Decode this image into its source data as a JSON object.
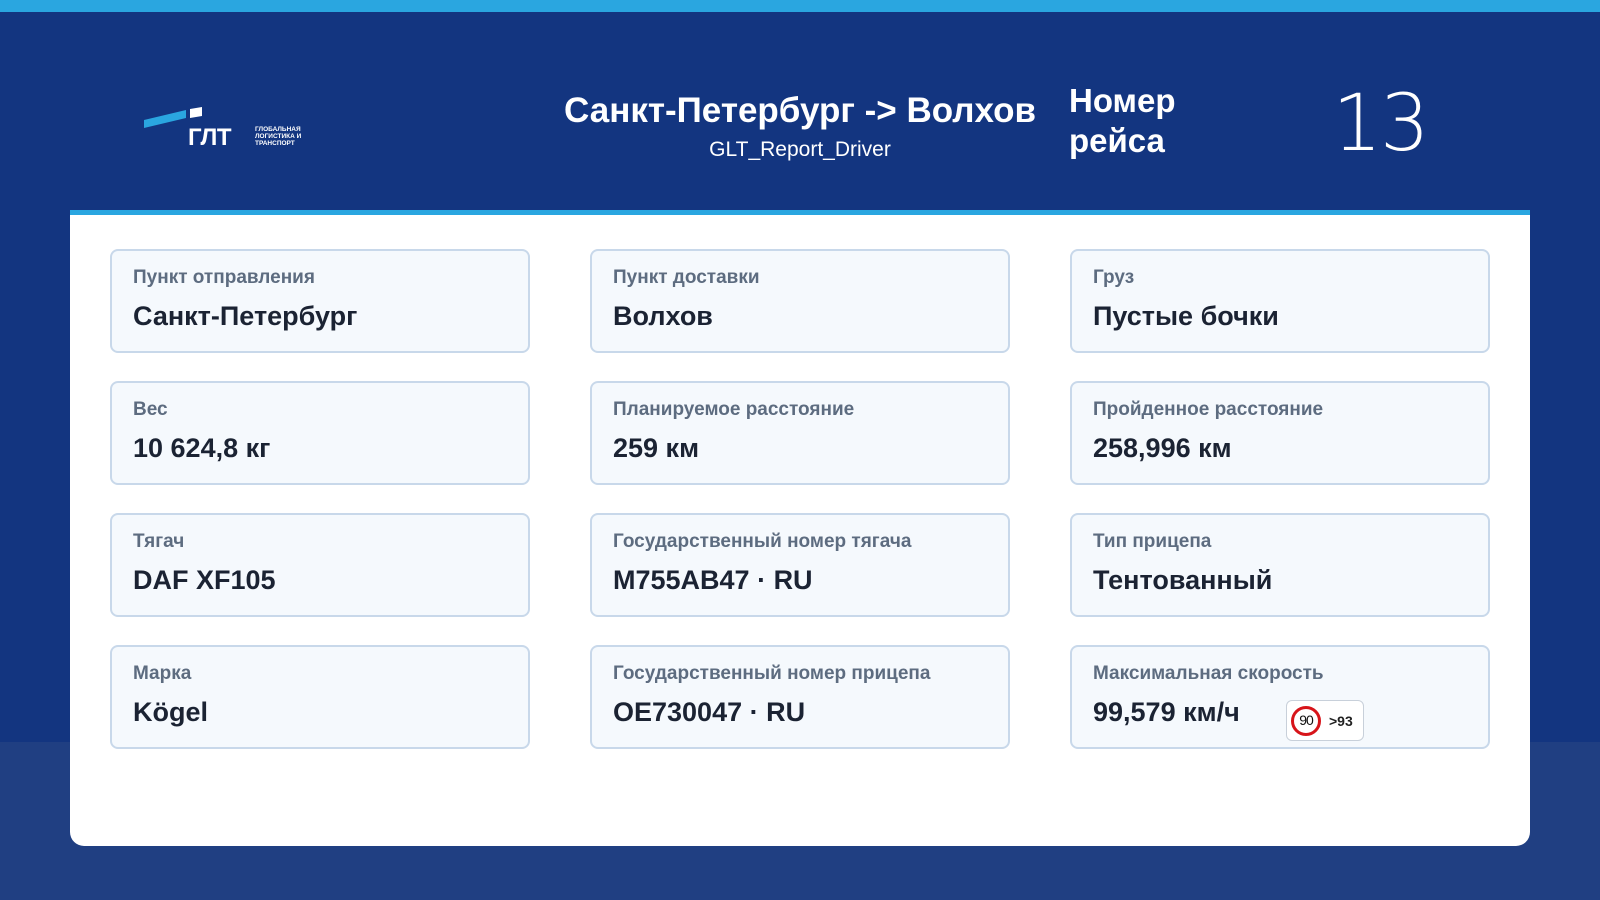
{
  "header": {
    "route": "Санкт-Петербург -> Волхов",
    "report_name": "GLT_Report_Driver",
    "trip_label": "Номер рейса",
    "trip_number": "13",
    "logo": {
      "abbr": "ГЛТ",
      "lines": [
        "ГЛОБАЛЬНАЯ",
        "ЛОГИСТИКА И",
        "ТРАНСПОРТ"
      ]
    }
  },
  "cards": {
    "departure": {
      "label": "Пункт отправления",
      "value": "Санкт-Петербург"
    },
    "delivery": {
      "label": "Пункт доставки",
      "value": "Волхов"
    },
    "cargo": {
      "label": "Груз",
      "value": "Пустые бочки"
    },
    "weight": {
      "label": "Вес",
      "value": "10 624,8 кг"
    },
    "planned_distance": {
      "label": "Планируемое расстояние",
      "value": "259 км"
    },
    "traveled_distance": {
      "label": "Пройденное расстояние",
      "value": "258,996 км"
    },
    "tractor": {
      "label": "Тягач",
      "value": "DAF XF105"
    },
    "tractor_plate": {
      "label": "Государственный номер тягача",
      "value": "M755AB47 · RU"
    },
    "trailer_type": {
      "label": "Тип прицепа",
      "value": "Тентованный"
    },
    "brand": {
      "label": "Марка",
      "value": "Kögel"
    },
    "trailer_plate": {
      "label": "Государственный номер прицепа",
      "value": "OE730047 · RU"
    },
    "max_speed": {
      "label": "Максимальная скорость",
      "value": "99,579 км/ч",
      "limit": "90",
      "excess": ">93"
    }
  },
  "colors": {
    "top_stripe": "#2aa6e0",
    "header_bg": "#133580",
    "page_bg": "#203f82",
    "panel_accent": "#2aa6e0",
    "card_bg": "#f5f9fd",
    "card_border": "#c8d8ea",
    "speed_sign_red": "#d7141a"
  },
  "icons": {
    "logo": "glt-logo-icon",
    "speed_sign": "speed-limit-sign-icon"
  }
}
